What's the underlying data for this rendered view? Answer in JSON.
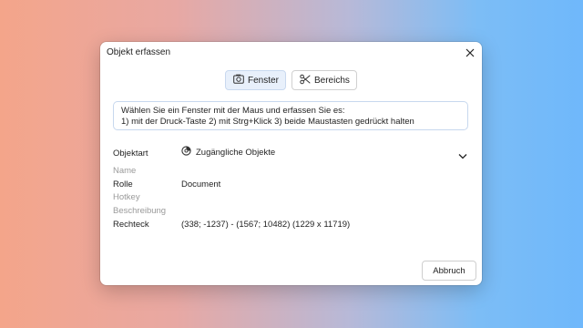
{
  "dialog": {
    "title": "Objekt erfassen",
    "close_icon": "close-icon"
  },
  "modes": {
    "window_label": "Fenster",
    "window_icon": "camera-icon",
    "region_label": "Bereichs",
    "region_icon": "scissors-icon",
    "active": "Fenster"
  },
  "info": {
    "line1": "Wählen Sie ein Fenster mit der Maus und erfassen Sie es:",
    "line2": "1) mit der Druck-Taste  2) mit Strg+Klick  3) beide Maustasten gedrückt halten"
  },
  "properties": {
    "objektart_label": "Objektart",
    "objektart_value": "Zugängliche Objekte",
    "objektart_icon": "accessibility-objects-icon",
    "name_label": "Name",
    "rolle_label": "Rolle",
    "rolle_value": "Document",
    "hotkey_label": "Hotkey",
    "beschreibung_label": "Beschreibung",
    "rechteck_label": "Rechteck",
    "rechteck_value": "(338; -1237) - (1567; 10482) (1229 x 11719)"
  },
  "footer": {
    "cancel_label": "Abbruch"
  },
  "colors": {
    "active_mode_bg": "#e8f0fb",
    "info_border": "#c7d8ee",
    "muted_label": "#9a9a9a"
  }
}
